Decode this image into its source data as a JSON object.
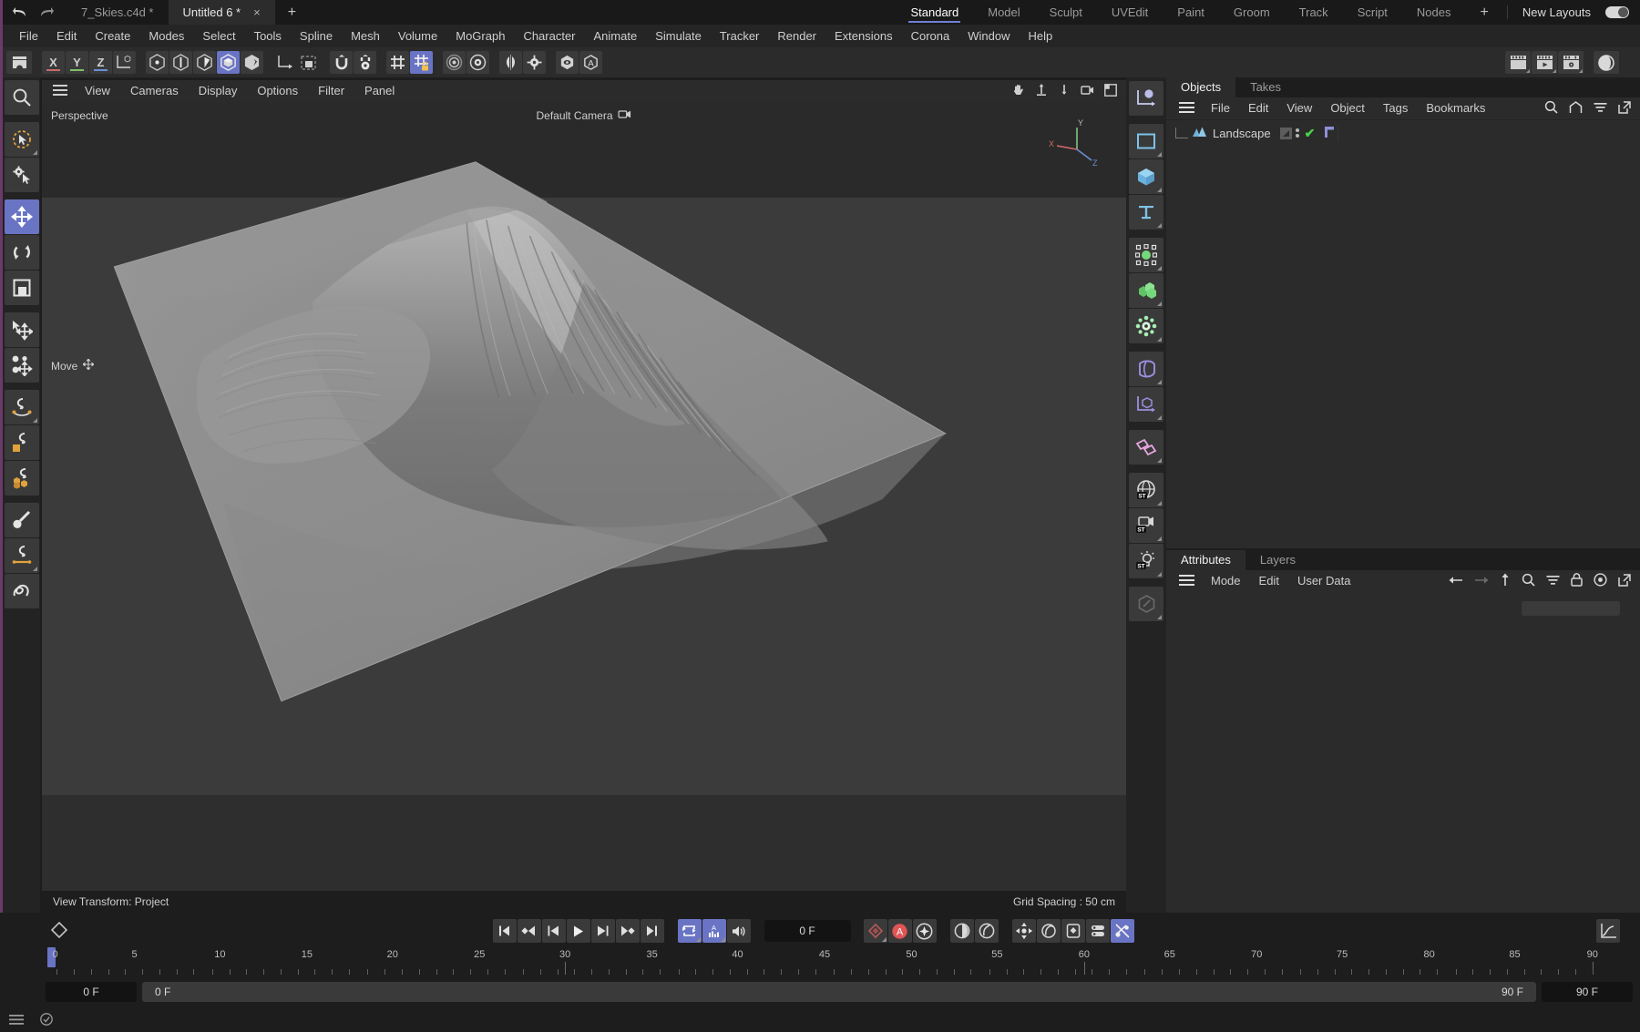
{
  "window": {
    "tabs": [
      {
        "label": "7_Skies.c4d *",
        "active": false,
        "closable": false
      },
      {
        "label": "Untitled 6 *",
        "active": true,
        "closable": true
      }
    ],
    "new_tab_label": "+",
    "close_label": "×",
    "undo_icon": "undo-icon",
    "redo_icon": "redo-icon"
  },
  "layouts": {
    "items": [
      {
        "label": "Standard",
        "active": true
      },
      {
        "label": "Model",
        "active": false
      },
      {
        "label": "Sculpt",
        "active": false
      },
      {
        "label": "UVEdit",
        "active": false
      },
      {
        "label": "Paint",
        "active": false
      },
      {
        "label": "Groom",
        "active": false
      },
      {
        "label": "Track",
        "active": false
      },
      {
        "label": "Script",
        "active": false
      },
      {
        "label": "Nodes",
        "active": false
      }
    ],
    "add_label": "+",
    "new_layouts_label": "New Layouts",
    "accent_color": "#6f7fd6"
  },
  "menubar": {
    "items": [
      "File",
      "Edit",
      "Create",
      "Modes",
      "Select",
      "Tools",
      "Spline",
      "Mesh",
      "Volume",
      "MoGraph",
      "Character",
      "Animate",
      "Simulate",
      "Tracker",
      "Render",
      "Extensions",
      "Corona",
      "Window",
      "Help"
    ]
  },
  "main_toolbar": {
    "groups": [
      {
        "buttons": [
          {
            "name": "undo-history-icon",
            "glyph": "archive",
            "selected": false
          }
        ]
      },
      {
        "buttons": [
          {
            "name": "axis-x-lock",
            "glyph": "X",
            "selected": false,
            "underline": "#c86a6a"
          },
          {
            "name": "axis-y-lock",
            "glyph": "Y",
            "selected": false,
            "underline": "#7fbf6a"
          },
          {
            "name": "axis-z-lock",
            "glyph": "Z",
            "selected": false,
            "underline": "#6a8fd6"
          },
          {
            "name": "world-object-axis",
            "glyph": "axis-cube",
            "selected": false
          }
        ]
      },
      {
        "buttons": [
          {
            "name": "point-mode-icon",
            "glyph": "hex-point",
            "selected": false
          },
          {
            "name": "edge-mode-icon",
            "glyph": "hex-edge",
            "selected": false
          },
          {
            "name": "polygon-mode-icon",
            "glyph": "hex-poly",
            "selected": false
          },
          {
            "name": "model-mode-icon",
            "glyph": "hex-model",
            "selected": true
          },
          {
            "name": "texture-mode-icon",
            "glyph": "hex-texture",
            "selected": false
          }
        ]
      },
      {
        "buttons": [
          {
            "name": "object-axis-icon",
            "glyph": "axis-L",
            "selected": false
          },
          {
            "name": "texture-axis-icon",
            "glyph": "square-corner",
            "selected": false
          }
        ]
      },
      {
        "buttons": [
          {
            "name": "snap-enable-icon",
            "glyph": "magnet",
            "selected": false
          },
          {
            "name": "snap-settings-icon",
            "glyph": "magnet-gear",
            "selected": false
          }
        ]
      },
      {
        "buttons": [
          {
            "name": "workplane-icon",
            "glyph": "grid",
            "selected": false
          },
          {
            "name": "workplane-lock-icon",
            "glyph": "grid-lock",
            "selected": true
          }
        ]
      },
      {
        "buttons": [
          {
            "name": "render-region-icon",
            "glyph": "target",
            "selected": false
          },
          {
            "name": "render-settings-icon",
            "glyph": "gear-circle",
            "selected": false
          }
        ]
      },
      {
        "buttons": [
          {
            "name": "symmetry-icon",
            "glyph": "mirror",
            "selected": false
          },
          {
            "name": "symmetry-settings-icon",
            "glyph": "gear-small",
            "selected": false
          }
        ]
      },
      {
        "buttons": [
          {
            "name": "viewport-solo-icon",
            "glyph": "hex-eye",
            "selected": false
          },
          {
            "name": "annotation-icon",
            "glyph": "hex-A",
            "selected": false
          }
        ]
      },
      {
        "buttons": [
          {
            "name": "render-view-icon",
            "glyph": "clapper",
            "selected": false
          },
          {
            "name": "render-queue-icon",
            "glyph": "clapper-play",
            "selected": false
          },
          {
            "name": "render-settings-clapper-icon",
            "glyph": "clapper-gear",
            "selected": false
          }
        ]
      },
      {
        "buttons": [
          {
            "name": "material-preview-icon",
            "glyph": "sphere",
            "selected": false
          }
        ]
      }
    ]
  },
  "left_toolbar": {
    "items": [
      {
        "name": "magnifier-tool",
        "icon": "search-icon",
        "selected": false,
        "corner": false
      },
      {
        "name": "live-selection-tool",
        "icon": "lasso-cursor-icon",
        "selected": false,
        "corner": true
      },
      {
        "name": "tool-settings-tool",
        "icon": "gear-cursor-icon",
        "selected": false,
        "corner": false
      },
      {
        "name": "move-tool",
        "icon": "move-arrows-icon",
        "selected": true,
        "corner": false
      },
      {
        "name": "rotate-tool",
        "icon": "rotate-icon",
        "selected": false,
        "corner": false
      },
      {
        "name": "scale-tool",
        "icon": "scale-icon",
        "selected": false,
        "corner": false
      },
      {
        "name": "transform-tool",
        "icon": "cursor-move-icon",
        "selected": false,
        "corner": false
      },
      {
        "name": "duplicate-move-tool",
        "icon": "cluster-move-icon",
        "selected": false,
        "corner": false
      },
      {
        "name": "spline-pen-tool",
        "icon": "spline-pen-icon",
        "selected": false,
        "corner": true
      },
      {
        "name": "polygon-pen-tool",
        "icon": "poly-pen-icon",
        "selected": false,
        "corner": false
      },
      {
        "name": "brush-sculpt-tool",
        "icon": "cubes-pen-icon",
        "selected": false,
        "corner": false
      },
      {
        "name": "paint-brush-tool",
        "icon": "brush-icon",
        "selected": false,
        "corner": false
      },
      {
        "name": "paint-pen-tool",
        "icon": "pen-line-icon",
        "selected": false,
        "corner": true
      },
      {
        "name": "freehand-tool",
        "icon": "squiggle-icon",
        "selected": false,
        "corner": false
      }
    ]
  },
  "view_menu": {
    "hamburger": "hamburger-icon",
    "items": [
      "View",
      "Cameras",
      "Display",
      "Options",
      "Filter",
      "Panel"
    ],
    "right_icons": [
      "hand-icon",
      "zoom-in-icon",
      "zoom-out-icon",
      "camera-orbit-icon",
      "maximize-view-icon"
    ]
  },
  "viewport": {
    "perspective_label": "Perspective",
    "camera_label": "Default Camera",
    "camera_icon": "camera-icon",
    "tool_hint": "Move",
    "tool_hint_icon": "move-arrows-icon",
    "axis_x": "X",
    "axis_y": "Y",
    "axis_z": "Z",
    "view_transform": "View Transform: Project",
    "grid_spacing": "Grid Spacing : 50 cm",
    "object_name": "Landscape"
  },
  "right_toolbar": {
    "items": [
      {
        "name": "axis-plot-icon",
        "color": "#b9bde8",
        "corner": false
      },
      {
        "name": "spline-primitive-icon",
        "color": "#7fc2e8",
        "corner": true
      },
      {
        "name": "cube-primitive-icon",
        "color": "#7fc2e8",
        "corner": true
      },
      {
        "name": "text-primitive-icon",
        "color": "#7fc2e8",
        "corner": true
      },
      {
        "name": "nurbs-generator-icon",
        "color": "#76d87c",
        "corner": true
      },
      {
        "name": "array-generator-icon",
        "color": "#76d87c",
        "corner": true
      },
      {
        "name": "mograph-icon",
        "color": "#a8eeb2",
        "corner": true
      },
      {
        "name": "deformer-bend-icon",
        "color": "#9b8fe0",
        "corner": true
      },
      {
        "name": "scene-axis-icon",
        "color": "#9b8fe0",
        "corner": true
      },
      {
        "name": "field-icon",
        "color": "#e8a8e0",
        "corner": true
      },
      {
        "name": "environment-sky-icon",
        "color": "#d8d8d8",
        "corner": true
      },
      {
        "name": "camera-stage-icon",
        "color": "#d8d8d8",
        "corner": true
      },
      {
        "name": "light-icon",
        "color": "#d8d8d8",
        "corner": true
      },
      {
        "name": "material-node-icon",
        "color": "#6a6a6a",
        "corner": true
      }
    ]
  },
  "objects_panel": {
    "tabs": [
      {
        "label": "Objects",
        "active": true
      },
      {
        "label": "Takes",
        "active": false
      }
    ],
    "menu": [
      "File",
      "Edit",
      "View",
      "Object",
      "Tags",
      "Bookmarks"
    ],
    "right_icons": [
      "search-icon",
      "home-icon",
      "filter-icon",
      "open-external-icon"
    ],
    "tree": [
      {
        "name": "Landscape",
        "icon": "landscape-icon",
        "visible_check": "✔",
        "tags": [
          "texture-tag",
          "layer-tag"
        ]
      }
    ]
  },
  "attributes_panel": {
    "tabs": [
      {
        "label": "Attributes",
        "active": true
      },
      {
        "label": "Layers",
        "active": false
      }
    ],
    "menu": [
      "Mode",
      "Edit",
      "User Data"
    ],
    "right_icons": [
      "back-arrow-icon",
      "forward-arrow-icon",
      "up-arrow-icon",
      "search-icon",
      "filter-icon",
      "lock-icon",
      "target-icon",
      "open-external-icon"
    ]
  },
  "timeline": {
    "keyframe_icon": "keyframe-diamond-icon",
    "transport": [
      {
        "name": "go-to-start-button",
        "icon": "skip-start-icon",
        "selected": false
      },
      {
        "name": "previous-key-button",
        "icon": "prev-key-icon",
        "selected": false
      },
      {
        "name": "previous-frame-button",
        "icon": "step-back-icon",
        "selected": false
      },
      {
        "name": "play-button",
        "icon": "play-icon",
        "selected": false
      },
      {
        "name": "next-frame-button",
        "icon": "step-forward-icon",
        "selected": false
      },
      {
        "name": "next-key-button",
        "icon": "next-key-icon",
        "selected": false
      },
      {
        "name": "go-to-end-button",
        "icon": "skip-end-icon",
        "selected": false
      }
    ],
    "playmode": [
      {
        "name": "loop-button",
        "icon": "loop-icon",
        "selected": true,
        "corner": true
      },
      {
        "name": "sound-levels-button",
        "icon": "audio-levels-icon",
        "selected": true,
        "corner": true
      },
      {
        "name": "sound-button",
        "icon": "speaker-icon",
        "selected": false,
        "corner": false
      }
    ],
    "current_frame": "0 F",
    "record_group": [
      {
        "name": "record-keyframe-button",
        "icon": "record-diamond-icon",
        "selected": false,
        "corner": true
      },
      {
        "name": "autokey-button",
        "icon": "autokey-A-icon",
        "selected": false,
        "accent": "#e05555"
      },
      {
        "name": "keyframe-settings-button",
        "icon": "key-gear-icon",
        "selected": false
      }
    ],
    "position_group": [
      {
        "name": "key-position-button",
        "icon": "pos-key-icon",
        "selected": false
      },
      {
        "name": "key-rotation-button",
        "icon": "rot-key-icon",
        "selected": false
      }
    ],
    "param_group": [
      {
        "name": "key-param-position-button",
        "icon": "param-pos-icon",
        "selected": false
      },
      {
        "name": "key-param-scale-button",
        "icon": "param-scale-icon",
        "selected": false
      },
      {
        "name": "key-param-rotation-button",
        "icon": "param-rot-icon",
        "selected": false
      },
      {
        "name": "key-param-pla-button",
        "icon": "param-pla-icon",
        "selected": false
      },
      {
        "name": "key-selection-only-button",
        "icon": "key-off-icon",
        "selected": true
      }
    ],
    "curve_button": {
      "name": "timeline-curve-button",
      "icon": "curve-graph-icon"
    },
    "ruler": {
      "tick_labels": [
        "0",
        "5",
        "10",
        "15",
        "20",
        "25",
        "30",
        "35",
        "40",
        "45",
        "50",
        "55",
        "60",
        "65",
        "70",
        "75",
        "80",
        "85",
        "90"
      ],
      "min": 0,
      "max": 90,
      "playhead_frame": 0
    },
    "fields": {
      "current": "0 F",
      "range_start": "0 F",
      "range_end": "90 F",
      "preview_end": "90 F"
    }
  },
  "statusbar": {
    "icons": [
      "hamburger-icon",
      "checkmark-circle-icon"
    ]
  },
  "colors": {
    "accent_select": "#6a74c4",
    "panel_bg": "#2b2b2b",
    "window_bg": "#1d1d1d",
    "toolbar_btn": "#3a3a3a",
    "text": "#cfcfcf",
    "left_edge": "#6b3a6b"
  }
}
